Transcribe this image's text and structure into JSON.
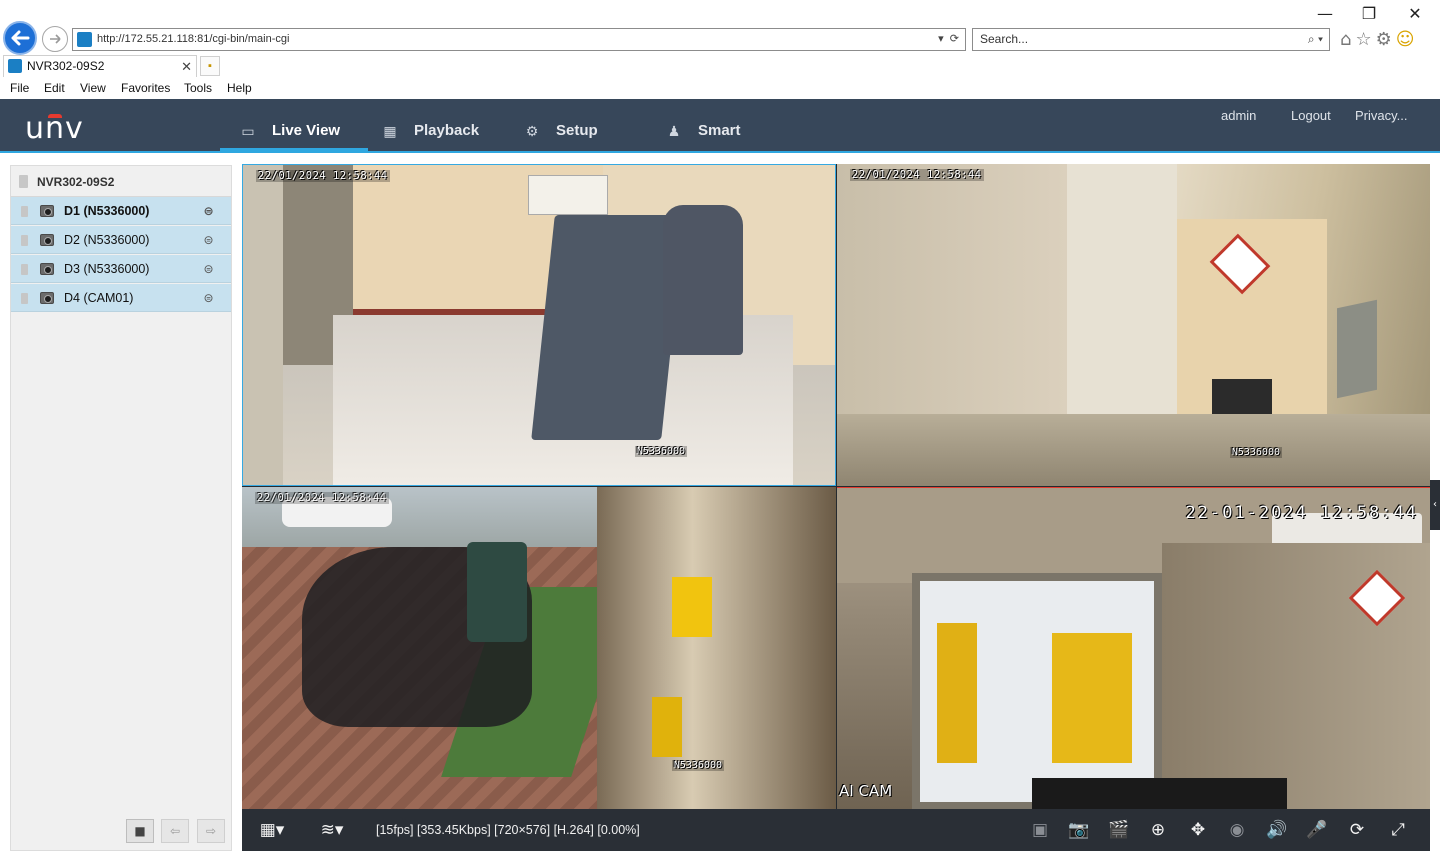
{
  "browser": {
    "url": "http://172.55.21.118:81/cgi-bin/main-cgi",
    "search_placeholder": "Search...",
    "tab_title": "NVR302-09S2",
    "menu": [
      "File",
      "Edit",
      "View",
      "Favorites",
      "Tools",
      "Help"
    ]
  },
  "app": {
    "logo": "unv",
    "nav": [
      {
        "label": "Live View",
        "icon": "monitor-icon",
        "active": true
      },
      {
        "label": "Playback",
        "icon": "film-icon",
        "active": false
      },
      {
        "label": "Setup",
        "icon": "gear-icon",
        "active": false
      },
      {
        "label": "Smart",
        "icon": "person-icon",
        "active": false
      }
    ],
    "user_links": [
      "admin",
      "Logout",
      "Privacy..."
    ]
  },
  "device_tree": {
    "nvr_name": "NVR302-09S2",
    "cameras": [
      {
        "label": "D1 (N5336000)",
        "selected": true
      },
      {
        "label": "D2 (N5336000)",
        "selected": false
      },
      {
        "label": "D3 (N5336000)",
        "selected": false
      },
      {
        "label": "D4 (CAM01)",
        "selected": false
      }
    ]
  },
  "tiles": [
    {
      "timestamp": "22/01/2024 12:58:44",
      "channel_label": "N5336000"
    },
    {
      "timestamp": "22/01/2024 12:58:44",
      "channel_label": "N5336000"
    },
    {
      "timestamp": "22/01/2024 12:58:44",
      "channel_label": "N5336000"
    },
    {
      "timestamp": "22-01-2024 12:58:44",
      "channel_label": "AI CAM"
    }
  ],
  "status_bar": {
    "stream_info": "[15fps] [353.45Kbps] [720×576] [H.264] [0.00%]"
  },
  "colors": {
    "header_bg": "#37475a",
    "accent": "#2fa7e0",
    "selected_row": "#c7e1ef"
  }
}
